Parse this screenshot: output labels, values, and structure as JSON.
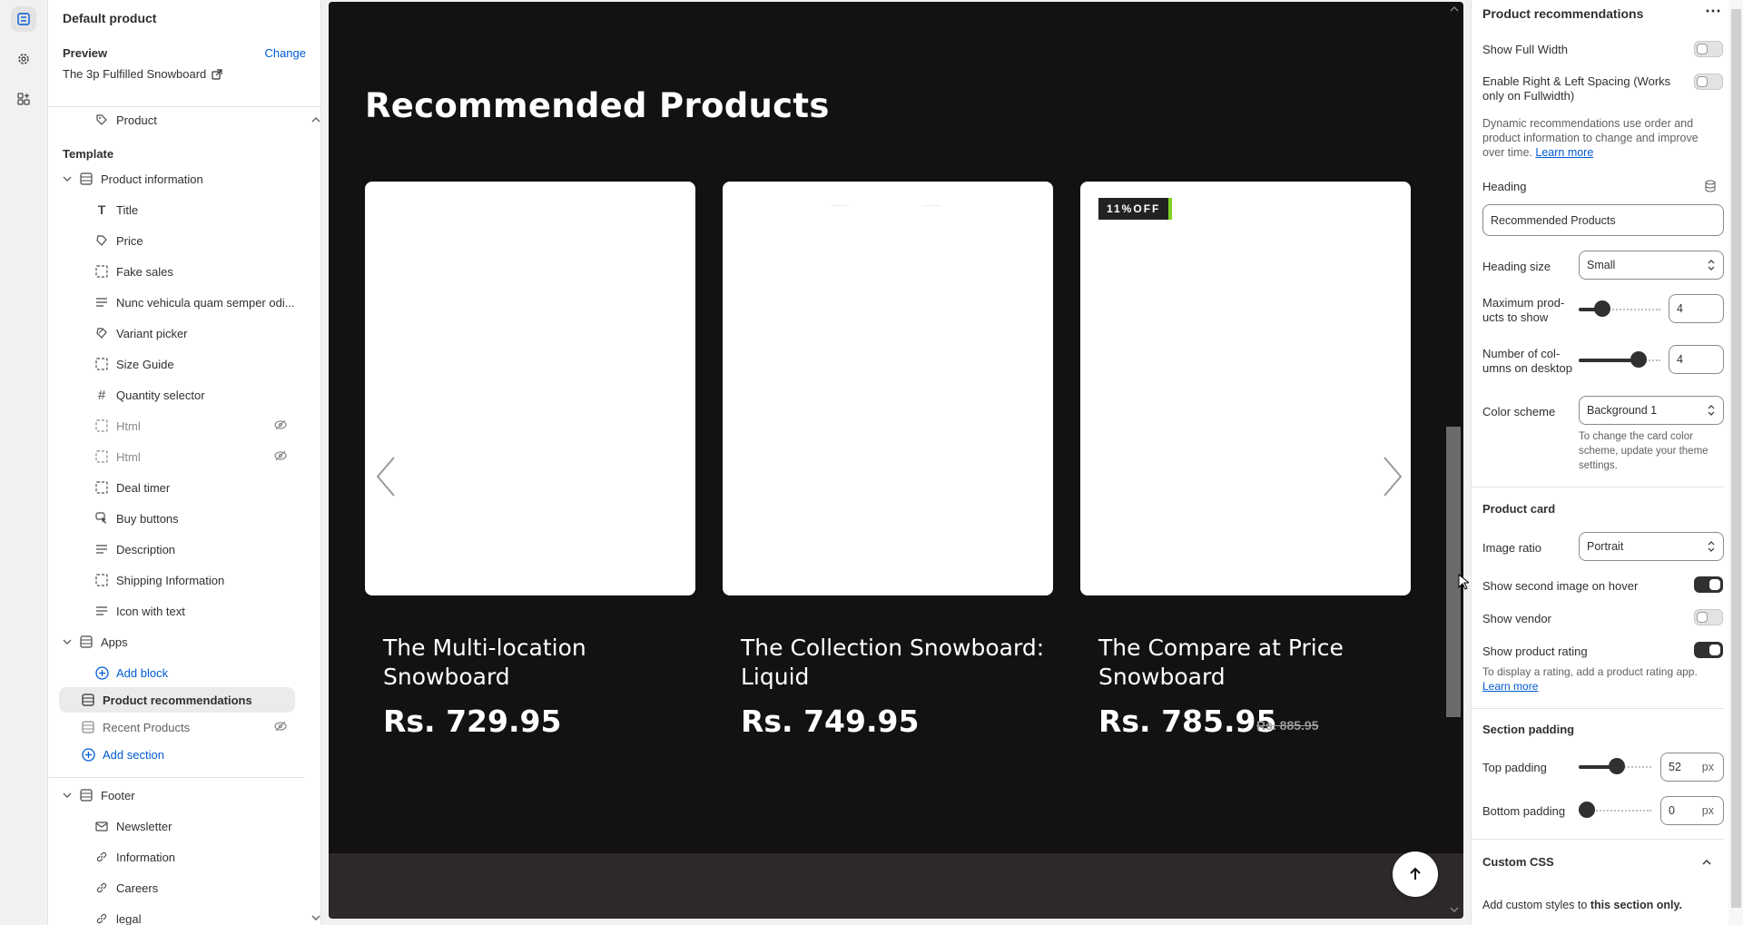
{
  "sidebar_rail": {
    "icons": [
      "sections-icon",
      "gear-icon",
      "apps-icon"
    ]
  },
  "left_panel": {
    "page_name": "Default product",
    "preview_label": "Preview",
    "change_label": "Change",
    "preview_product": "The 3p Fulfilled Snowboard",
    "product_item": "Product",
    "template_label": "Template",
    "product_information": "Product information",
    "blocks": [
      "Title",
      "Price",
      "Fake sales",
      "Nunc vehicula quam semper odi...",
      "Variant picker",
      "Size Guide",
      "Quantity selector",
      "Html",
      "Html",
      "Deal timer",
      "Buy buttons",
      "Description",
      "Shipping Information",
      "Icon with text"
    ],
    "apps_label": "Apps",
    "add_block": "Add block",
    "product_recommendations": "Product recommendations",
    "recent_products": "Recent Products",
    "add_section": "Add section",
    "footer_label": "Footer",
    "footer_blocks": [
      "Newsletter",
      "Information",
      "Careers",
      "legal"
    ]
  },
  "preview": {
    "heading": "Recommended Products",
    "badge": "11%OFF",
    "products": [
      {
        "title_line1": "The Multi-location",
        "title_line2": "Snowboard",
        "price": "Rs. 729.95"
      },
      {
        "title_line1": "The Collection Snowboard:",
        "title_line2": "Liquid",
        "price": "Rs. 749.95"
      },
      {
        "title_line1": "The Compare at Price",
        "title_line2": "Snowboard",
        "price": "Rs. 785.95",
        "compare_price": "Rs. 885.95"
      }
    ]
  },
  "right_panel": {
    "title": "Product recommendations",
    "show_full_width": "Show Full Width",
    "spacing_line1": "Enable Right & Left Spacing (Works",
    "spacing_line2": "only on Fullwidth)",
    "dynamic_line1": "Dynamic recommendations use order and",
    "dynamic_line2": "product information to change and improve",
    "dynamic_line3": "over time.",
    "learn_more": "Learn more",
    "heading_label": "Heading",
    "heading_value": "Recommended Products",
    "heading_size_label": "Heading size",
    "heading_size_value": "Small",
    "max_products_line1": "Maximum prod-",
    "max_products_line2": "ucts to show",
    "max_products_value": "4",
    "columns_line1": "Number of col-",
    "columns_line2": "umns on desktop",
    "columns_value": "4",
    "color_scheme_label": "Color scheme",
    "color_scheme_value": "Background 1",
    "color_hint_line1": "To change the card color",
    "color_hint_line2": "scheme, update your theme",
    "color_hint_line3": "settings.",
    "product_card_label": "Product card",
    "image_ratio_label": "Image ratio",
    "image_ratio_value": "Portrait",
    "second_image_label": "Show second image on hover",
    "show_vendor_label": "Show vendor",
    "show_rating_label": "Show product rating",
    "rating_hint": "To display a rating, add a product rating app.",
    "learn_more2": "Learn more",
    "section_padding_label": "Section padding",
    "top_padding_label": "Top padding",
    "top_padding_value": "52",
    "bottom_padding_label": "Bottom padding",
    "bottom_padding_value": "0",
    "px_unit": "px",
    "custom_css_label": "Custom CSS",
    "custom_css_hint_prefix": "Add custom styles to",
    "custom_css_hint_bold": "this section only.",
    "toggles": {
      "full_width": false,
      "spacing": false,
      "second_image": true,
      "vendor": false,
      "rating": true
    },
    "slider_levels": {
      "max_products": 0.1,
      "columns": 0.67,
      "top_padding": 0.52,
      "bottom_padding": 0.0
    }
  }
}
